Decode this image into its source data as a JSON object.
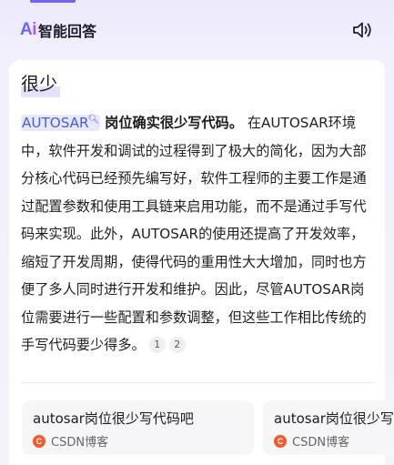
{
  "header": {
    "logo_text": "Ai",
    "title": "智能回答",
    "speaker_icon": "speaker-icon"
  },
  "query": "很少",
  "answer": {
    "keyword": "AUTOSAR",
    "lead": "岗位确实很少写代码。",
    "body": "在AUTOSAR环境中，软件开发和调试的过程得到了极大的简化，因为大部分核心代码已经预先编写好，软件工程师的主要工作是通过配置参数和使用工具链来启用功能，而不是通过手写代码来实现。此外，AUTOSAR的使用还提高了开发效率，缩短了开发周期，使得代码的重用性大大增加，同时也方便了多人同时进行开发和维护。因此，尽管AUTOSAR岗位需要进行一些配置和参数调整，但这些工作相比传统的手写代码要少得多。",
    "citations": [
      "1",
      "2"
    ]
  },
  "sources": [
    {
      "title": "autosar岗位很少写代码吧",
      "site": "CSDN博客",
      "icon": "csdn-icon",
      "accent": "#f15a2b"
    },
    {
      "title": "autosar岗位很少写代码",
      "site": "CSDN博客",
      "icon": "csdn-icon",
      "accent": "#f15a2b"
    }
  ],
  "colors": {
    "accent": "#6b66f5",
    "keyword": "#4a5bd8"
  }
}
